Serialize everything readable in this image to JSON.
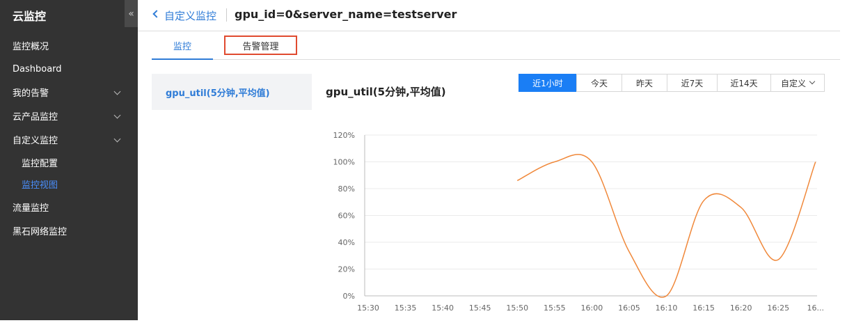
{
  "sidebar": {
    "title": "云监控",
    "collapse_icon": "«",
    "items": [
      {
        "label": "监控概况"
      },
      {
        "label": "Dashboard"
      },
      {
        "label": "我的告警"
      },
      {
        "label": "云产品监控"
      },
      {
        "label": "自定义监控"
      },
      {
        "label": "监控配置"
      },
      {
        "label": "监控视图"
      },
      {
        "label": "流量监控"
      },
      {
        "label": "黑石网络监控"
      }
    ]
  },
  "breadcrumb": {
    "parent": "自定义监控",
    "title": "gpu_id=0&server_name=testserver"
  },
  "tabs": [
    {
      "label": "监控"
    },
    {
      "label": "告警管理"
    }
  ],
  "metric_list": [
    {
      "label": "gpu_util(5分钟,平均值)"
    }
  ],
  "chart_title": "gpu_util(5分钟,平均值)",
  "time_range": {
    "options": [
      "近1小时",
      "今天",
      "昨天",
      "近7天",
      "近14天",
      "自定义"
    ],
    "selected": "近1小时"
  },
  "colors": {
    "accent": "#2f7cd7",
    "active_button": "#1a7ef5",
    "highlight_border": "#e04a2f",
    "series_line": "#f0883a",
    "sidebar_bg": "#333333"
  },
  "chart_data": {
    "type": "line",
    "x": [
      "15:30",
      "15:35",
      "15:40",
      "15:45",
      "15:50",
      "15:55",
      "16:00",
      "16:05",
      "16:10",
      "16:15",
      "16:20",
      "16:25",
      "16..."
    ],
    "series": [
      {
        "values": [
          null,
          null,
          null,
          null,
          86,
          100,
          100,
          33,
          0,
          71,
          66,
          27,
          100
        ]
      }
    ],
    "y_ticks": [
      "0%",
      "20%",
      "40%",
      "60%",
      "80%",
      "100%",
      "120%"
    ],
    "ylim": [
      0,
      120
    ],
    "grid": true
  }
}
